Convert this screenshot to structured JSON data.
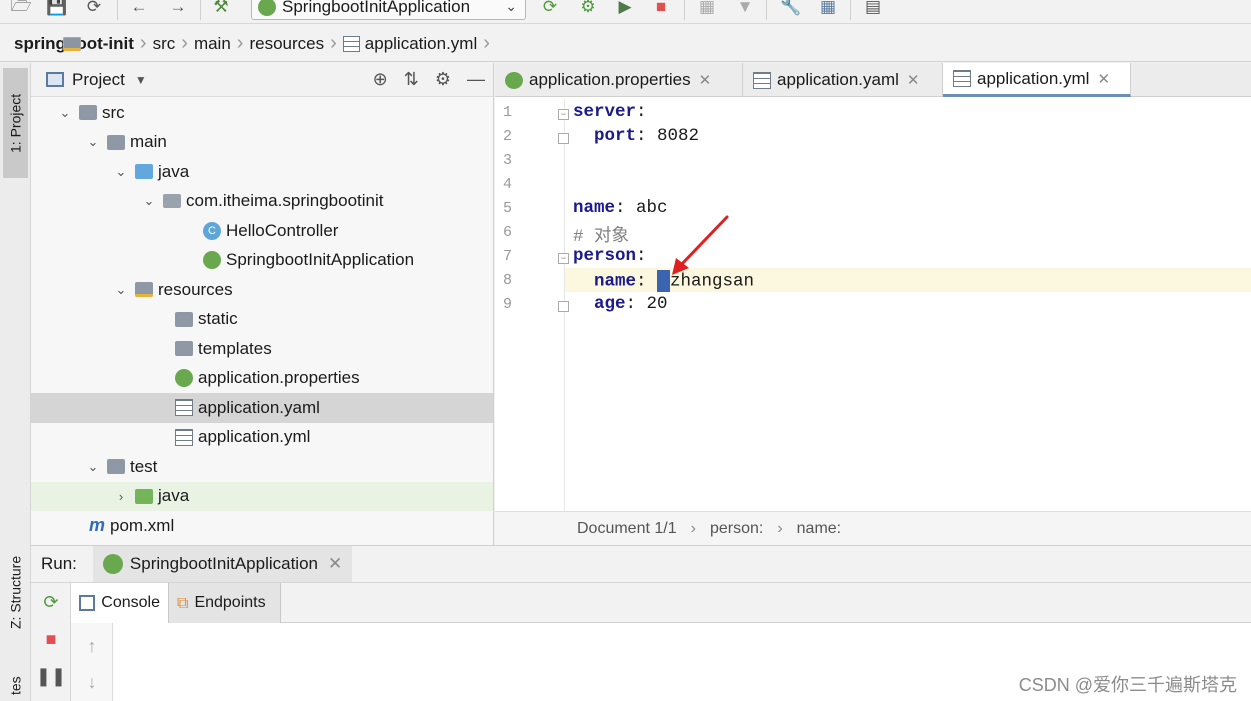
{
  "toolbar": {
    "run_config": "SpringbootInitApplication",
    "icons": [
      "folder-open-icon",
      "save-icon",
      "sync-icon",
      "back-icon",
      "forward-icon",
      "build-icon",
      "run-icon",
      "debug-icon",
      "coverage-icon",
      "stop-icon",
      "project-structure-icon",
      "settings-icon",
      "sdk-icon",
      "terminal-icon"
    ]
  },
  "breadcrumb": {
    "items": [
      "springboot-init",
      "src",
      "main",
      "resources",
      "application.yml"
    ]
  },
  "left_strip": {
    "project_tab": "1: Project",
    "structure_tab": "Z: Structure",
    "favorites_tab": "tes"
  },
  "project_panel": {
    "title": "Project",
    "tree": [
      {
        "label": "src",
        "icon": "folder",
        "arrow": "down"
      },
      {
        "label": "main",
        "icon": "folder",
        "arrow": "down"
      },
      {
        "label": "java",
        "icon": "source-folder",
        "arrow": "down"
      },
      {
        "label": "com.itheima.springbootinit",
        "icon": "package",
        "arrow": "down"
      },
      {
        "label": "HelloController",
        "icon": "class"
      },
      {
        "label": "SpringbootInitApplication",
        "icon": "spring-class"
      },
      {
        "label": "resources",
        "icon": "resources-folder",
        "arrow": "down"
      },
      {
        "label": "static",
        "icon": "folder"
      },
      {
        "label": "templates",
        "icon": "folder"
      },
      {
        "label": "application.properties",
        "icon": "spring-properties"
      },
      {
        "label": "application.yaml",
        "icon": "yaml",
        "selected": true
      },
      {
        "label": "application.yml",
        "icon": "yaml"
      },
      {
        "label": "test",
        "icon": "folder",
        "arrow": "down"
      },
      {
        "label": "java",
        "icon": "test-folder",
        "arrow": "right"
      },
      {
        "label": "pom.xml",
        "icon": "maven"
      }
    ]
  },
  "editor": {
    "tabs": [
      {
        "label": "application.properties",
        "icon": "spring"
      },
      {
        "label": "application.yaml",
        "icon": "yaml"
      },
      {
        "label": "application.yml",
        "icon": "yaml",
        "active": true
      }
    ],
    "lines": [
      {
        "n": "1",
        "key": "server",
        "sep": ":",
        "val": "",
        "indent": ""
      },
      {
        "n": "2",
        "key": "port",
        "sep": ": ",
        "val": "8082",
        "indent": "  "
      },
      {
        "n": "3",
        "key": "",
        "sep": "",
        "val": "",
        "indent": ""
      },
      {
        "n": "4",
        "key": "",
        "sep": "",
        "val": "",
        "indent": ""
      },
      {
        "n": "5",
        "key": "name",
        "sep": ": ",
        "val": "abc",
        "indent": ""
      },
      {
        "n": "6",
        "comment": "# 对象"
      },
      {
        "n": "7",
        "key": "person",
        "sep": ":",
        "val": "",
        "indent": ""
      },
      {
        "n": "8",
        "key": "name",
        "sep": ": ",
        "val": "zhangsan",
        "indent": "  "
      },
      {
        "n": "9",
        "key": "age",
        "sep": ": ",
        "val": "20",
        "indent": "  "
      }
    ],
    "status": {
      "document": "Document 1/1",
      "path1": "person:",
      "path2": "name:"
    }
  },
  "run_panel": {
    "label": "Run:",
    "config_tab": "SpringbootInitApplication",
    "console_tab": "Console",
    "endpoints_tab": "Endpoints"
  },
  "watermark": "CSDN @爱你三千遍斯塔克",
  "colors": {
    "accent": "#3a63b0",
    "keyword": "#1a1a8a",
    "spring_green": "#6aa84f",
    "stop_red": "#e05050",
    "annotation_arrow": "#e02020"
  }
}
